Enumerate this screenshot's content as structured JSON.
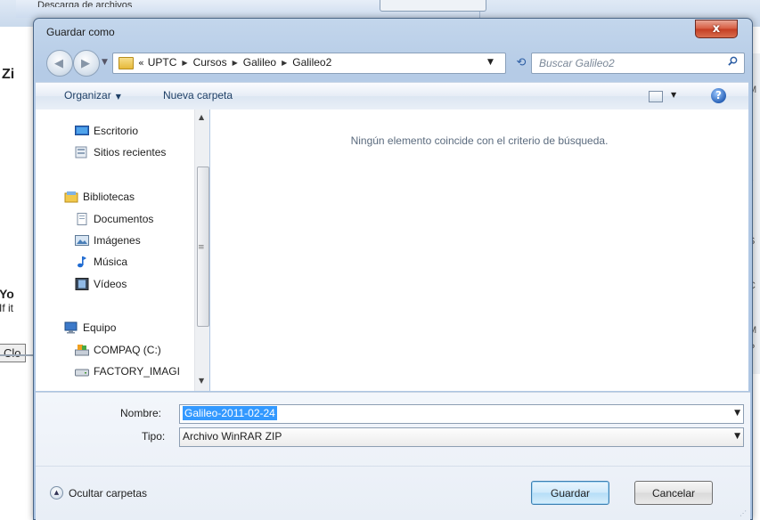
{
  "background": {
    "parent_title": "Descarga de archivos",
    "left_heading": "Zi",
    "left_you": "Yo",
    "left_ifit": "If it",
    "left_close": "Clo",
    "right_letters": [
      "M",
      "s",
      "S",
      "C",
      "M",
      "P"
    ]
  },
  "dialog": {
    "title": "Guardar como",
    "close_symbol": "x",
    "breadcrumb": {
      "overflow": "«",
      "parts": [
        "UPTC",
        "Cursos",
        "Galileo",
        "Galileo2"
      ]
    },
    "search_placeholder": "Buscar Galileo2",
    "toolbar": {
      "organize": "Organizar",
      "new_folder": "Nueva carpeta",
      "help": "?"
    },
    "nav_pane": {
      "favorites": [
        {
          "label": "Escritorio",
          "icon": "desktop-icon"
        },
        {
          "label": "Sitios recientes",
          "icon": "recent-places-icon"
        }
      ],
      "libraries_header": "Bibliotecas",
      "libraries": [
        {
          "label": "Documentos",
          "icon": "documents-icon"
        },
        {
          "label": "Imágenes",
          "icon": "pictures-icon"
        },
        {
          "label": "Música",
          "icon": "music-icon"
        },
        {
          "label": "Vídeos",
          "icon": "videos-icon"
        }
      ],
      "computer_header": "Equipo",
      "drives": [
        {
          "label": "COMPAQ (C:)",
          "icon": "drive-c-icon"
        },
        {
          "label": "FACTORY_IMAGI",
          "icon": "drive-icon"
        }
      ]
    },
    "empty_message": "Ningún elemento coincide con el criterio de búsqueda.",
    "filename_label": "Nombre:",
    "filename_value": "Galileo-2011-02-24",
    "type_label": "Tipo:",
    "type_value": "Archivo WinRAR ZIP",
    "hide_folders": "Ocultar carpetas",
    "save_button": "Guardar",
    "cancel_button": "Cancelar"
  },
  "colors": {
    "window_frame": "#b5cbe6",
    "close_red": "#c43d22",
    "selection": "#3399ff",
    "primary_button": "#b5ddf7"
  }
}
